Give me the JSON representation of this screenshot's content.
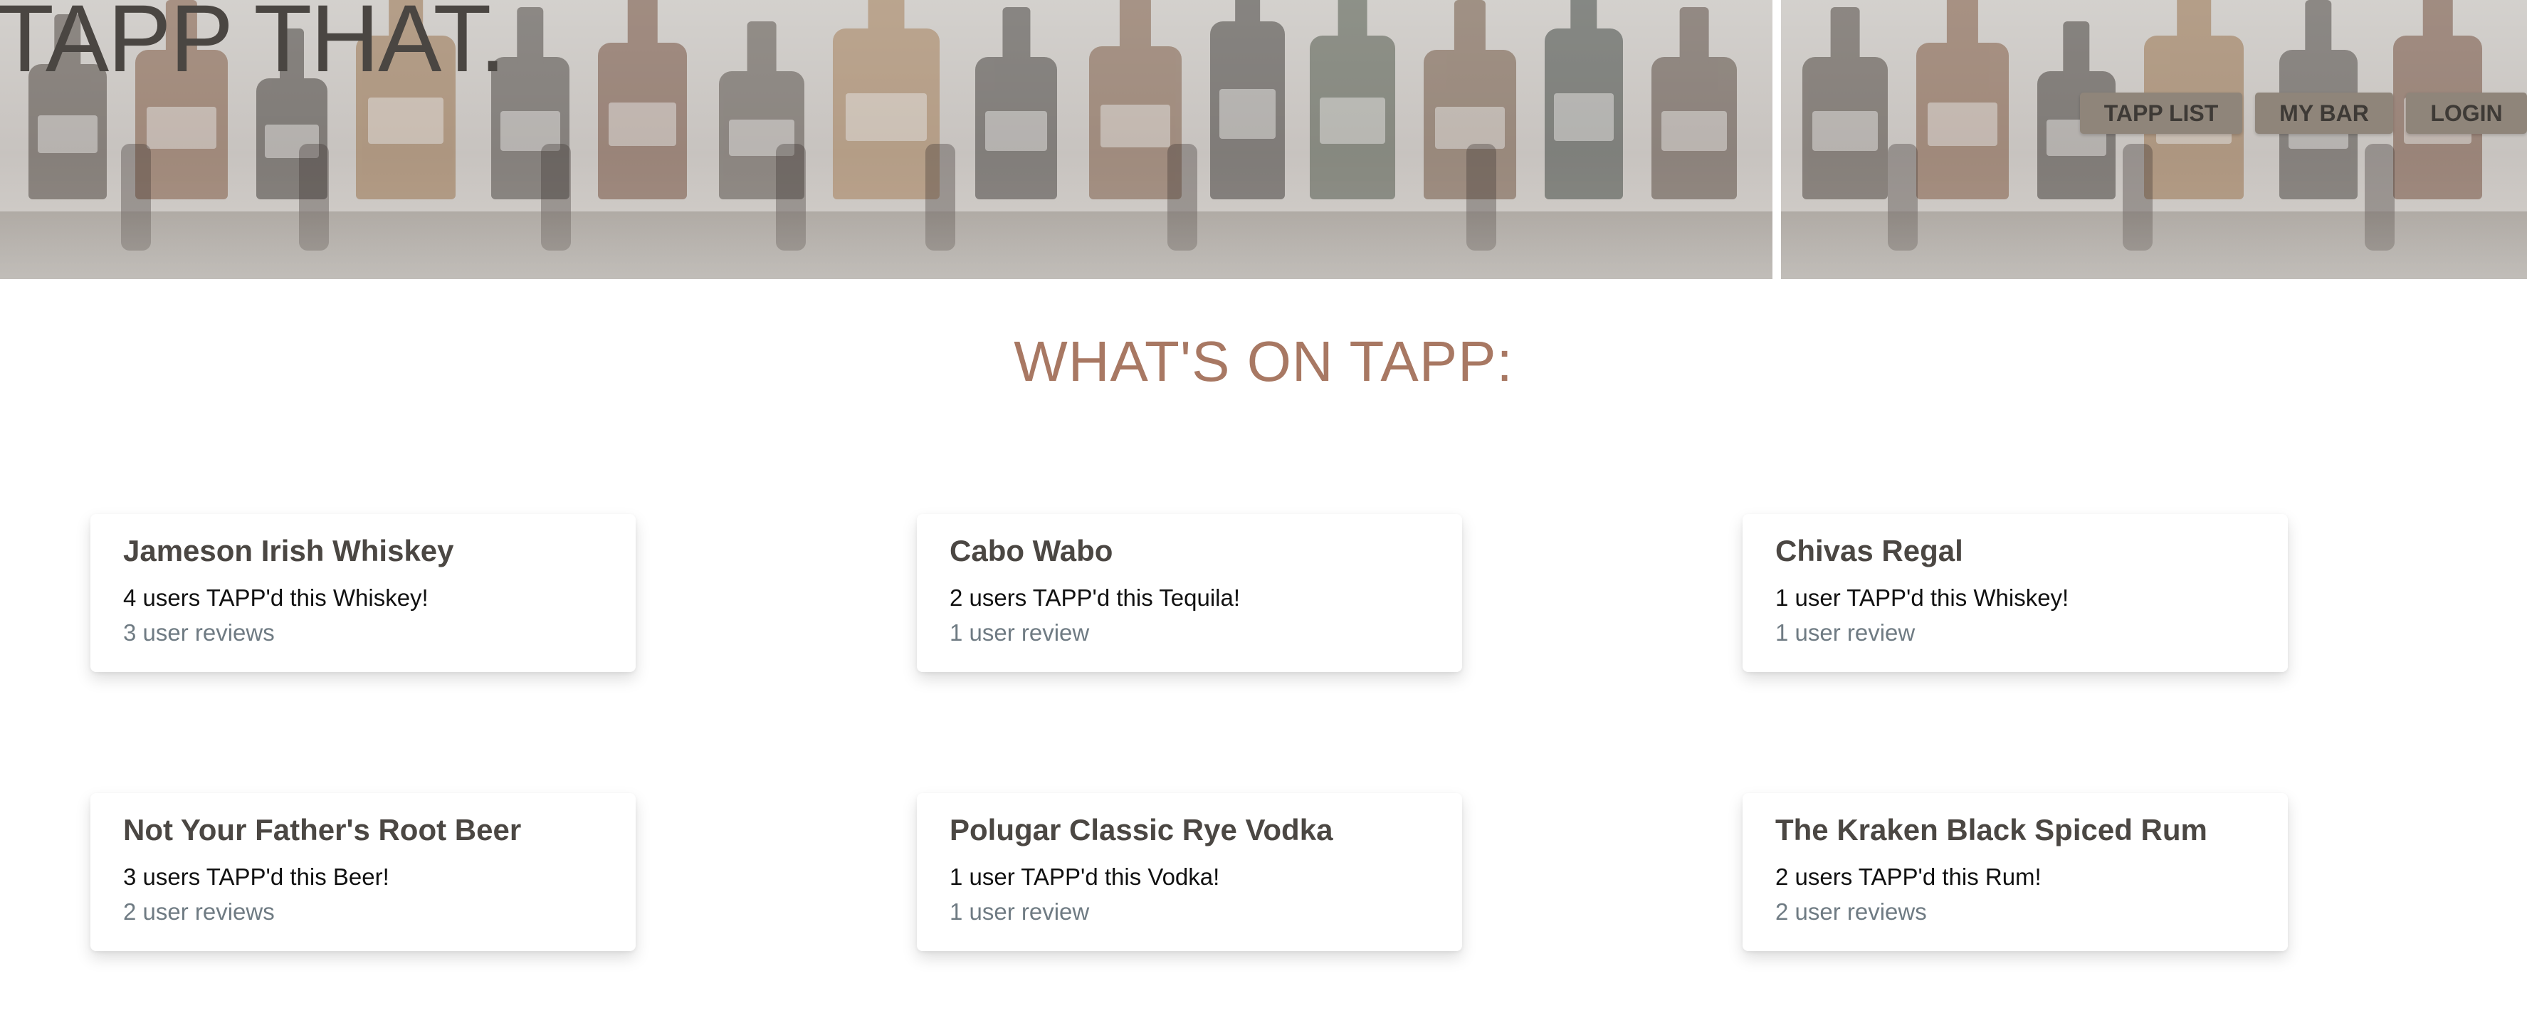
{
  "header": {
    "brand": "TAPP THAT.",
    "nav": {
      "tapp_list": "TAPP LIST",
      "my_bar": "MY BAR",
      "login": "LOGIN"
    }
  },
  "main": {
    "title": "WHAT'S ON TAPP:",
    "cards": [
      {
        "name": "Jameson Irish Whiskey",
        "count_text": "4 users TAPP'd this Whiskey!",
        "reviews_text": "3 user reviews"
      },
      {
        "name": "Cabo Wabo",
        "count_text": "2 users TAPP'd this Tequila!",
        "reviews_text": "1 user review"
      },
      {
        "name": "Chivas Regal",
        "count_text": "1 user TAPP'd this Whiskey!",
        "reviews_text": "1 user review"
      },
      {
        "name": "Not Your Father's Root Beer",
        "count_text": "3 users TAPP'd this Beer!",
        "reviews_text": "2 user reviews"
      },
      {
        "name": "Polugar Classic Rye Vodka",
        "count_text": "1 user TAPP'd this Vodka!",
        "reviews_text": "1 user review"
      },
      {
        "name": "The Kraken Black Spiced Rum",
        "count_text": "2 users TAPP'd this Rum!",
        "reviews_text": "2 user reviews"
      }
    ]
  },
  "colors": {
    "accent_title": "#a87863",
    "nav_button_bg": "#8f857a",
    "card_text": "#4b4743",
    "review_link": "#6f7b83"
  }
}
